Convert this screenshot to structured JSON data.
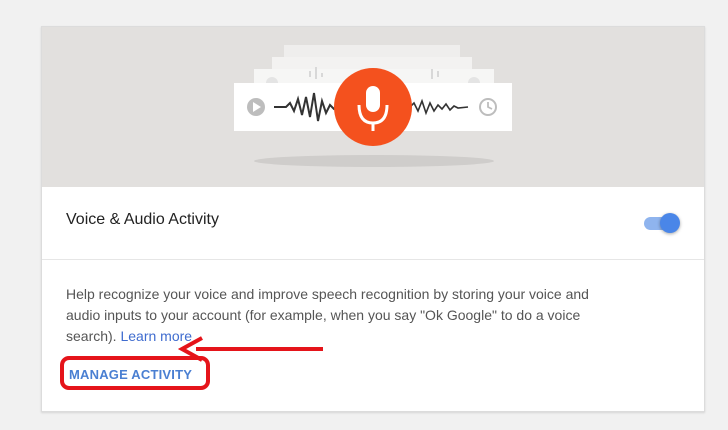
{
  "card": {
    "setting_title": "Voice & Audio Activity",
    "toggle_on": true,
    "description": "Help recognize your voice and improve speech recognition by storing your voice and audio inputs to your account (for example, when you say \"Ok Google\" to do a voice search).",
    "learn_more": "Learn more",
    "manage_button": "MANAGE ACTIVITY"
  },
  "colors": {
    "accent_blue": "#4a86e8",
    "mic_orange": "#f4511e",
    "annotation_red": "#e5141a"
  }
}
